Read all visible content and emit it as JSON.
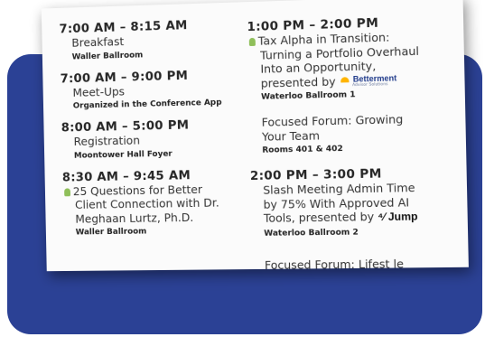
{
  "schedule_left": [
    {
      "time": "7:00 AM – 8:15 AM",
      "title": "Breakfast",
      "room": "Waller Ballroom"
    },
    {
      "time": "7:00 AM – 9:00 PM",
      "title": "Meet-Ups",
      "room": "Organized in the Conference App"
    },
    {
      "time": "8:00 AM – 5:00 PM",
      "title": "Registration",
      "room": "Moontower Hall Foyer"
    },
    {
      "time": "8:30 AM – 9:45 AM",
      "title_line1": "25 Questions for Better",
      "title_line2": "Client Connection with Dr.",
      "title_line3": "Meghaan Lurtz, Ph.D.",
      "room": "Waller Ballroom"
    }
  ],
  "schedule_right": [
    {
      "time": "1:00 PM – 2:00 PM",
      "title_line1": "Tax Alpha in Transition:",
      "title_line2": "Turning a Portfolio Overhaul",
      "title_line3": "Into an Opportunity,",
      "title_line4": "presented by",
      "sponsor_name": "Betterment",
      "sponsor_sub": "Advisor Solutions",
      "room": "Waterloo Ballroom 1"
    },
    {
      "title_line1": "Focused Forum: Growing",
      "title_line2": "Your Team",
      "room": "Rooms 401 & 402"
    },
    {
      "time": "2:00 PM – 3:00 PM",
      "title_line1": "Slash Meeting Admin Time",
      "title_line2": "by 75% With Approved AI",
      "title_line3": "Tools, presented by",
      "sponsor_name": "Jump",
      "room": "Waterloo Ballroom 2"
    }
  ],
  "cut_off_text": "Focused Forum: Lifest le",
  "colors": {
    "panel": "#2b4195",
    "leaf": "#8fbf5a"
  }
}
